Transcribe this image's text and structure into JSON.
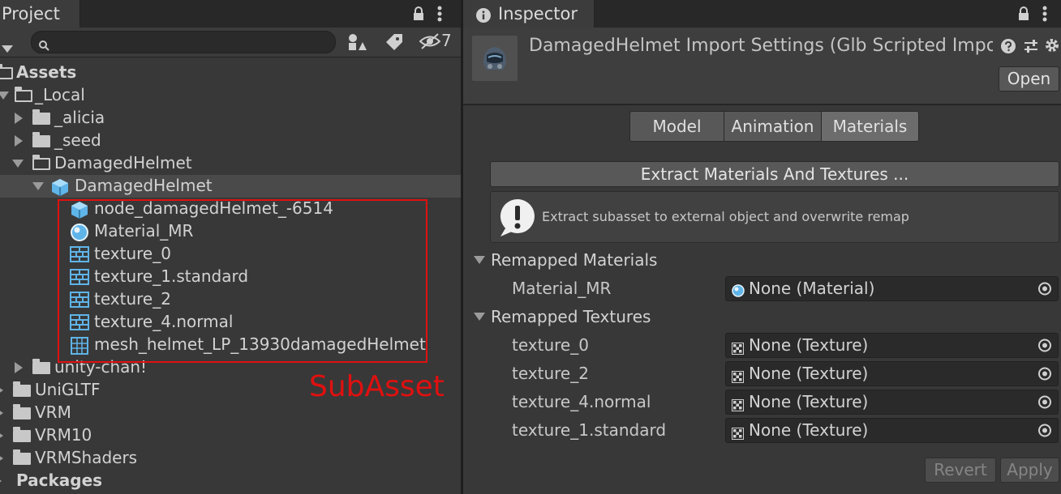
{
  "project": {
    "tab_title": "Project",
    "hidden_count": "7",
    "search": {
      "placeholder": ""
    },
    "tree": [
      {
        "label": "Assets",
        "bold": true
      },
      {
        "label": "_Local"
      },
      {
        "label": "_alicia"
      },
      {
        "label": "_seed"
      },
      {
        "label": "DamagedHelmet"
      },
      {
        "label": "DamagedHelmet"
      },
      {
        "label": "node_damagedHelmet_-6514"
      },
      {
        "label": "Material_MR"
      },
      {
        "label": "texture_0"
      },
      {
        "label": "texture_1.standard"
      },
      {
        "label": "texture_2"
      },
      {
        "label": "texture_4.normal"
      },
      {
        "label": "mesh_helmet_LP_13930damagedHelmet"
      },
      {
        "label": "unity-chan!"
      },
      {
        "label": "UniGLTF"
      },
      {
        "label": "VRM"
      },
      {
        "label": "VRM10"
      },
      {
        "label": "VRMShaders"
      },
      {
        "label": "Packages",
        "bold": true
      }
    ],
    "annotation": "SubAsset"
  },
  "inspector": {
    "tab_title": "Inspector",
    "title": "DamagedHelmet Import Settings (Glb Scripted Importer)",
    "open_button": "Open",
    "tabs": [
      "Model",
      "Animation",
      "Materials"
    ],
    "active_tab": "Materials",
    "extract_button": "Extract Materials And Textures ...",
    "help_text": "Extract subasset to external object and overwrite remap",
    "remapped_materials": {
      "header": "Remapped Materials",
      "rows": [
        {
          "label": "Material_MR",
          "value": "None (Material)"
        }
      ]
    },
    "remapped_textures": {
      "header": "Remapped Textures",
      "rows": [
        {
          "label": "texture_0",
          "value": "None (Texture)"
        },
        {
          "label": "texture_2",
          "value": "None (Texture)"
        },
        {
          "label": "texture_4.normal",
          "value": "None (Texture)"
        },
        {
          "label": "texture_1.standard",
          "value": "None (Texture)"
        }
      ]
    },
    "revert_button": "Revert",
    "apply_button": "Apply"
  },
  "colors": {
    "panel_bg": "#383838",
    "annotation_red": "#e01010",
    "asset_icon_blue": "#5fb4e8"
  }
}
